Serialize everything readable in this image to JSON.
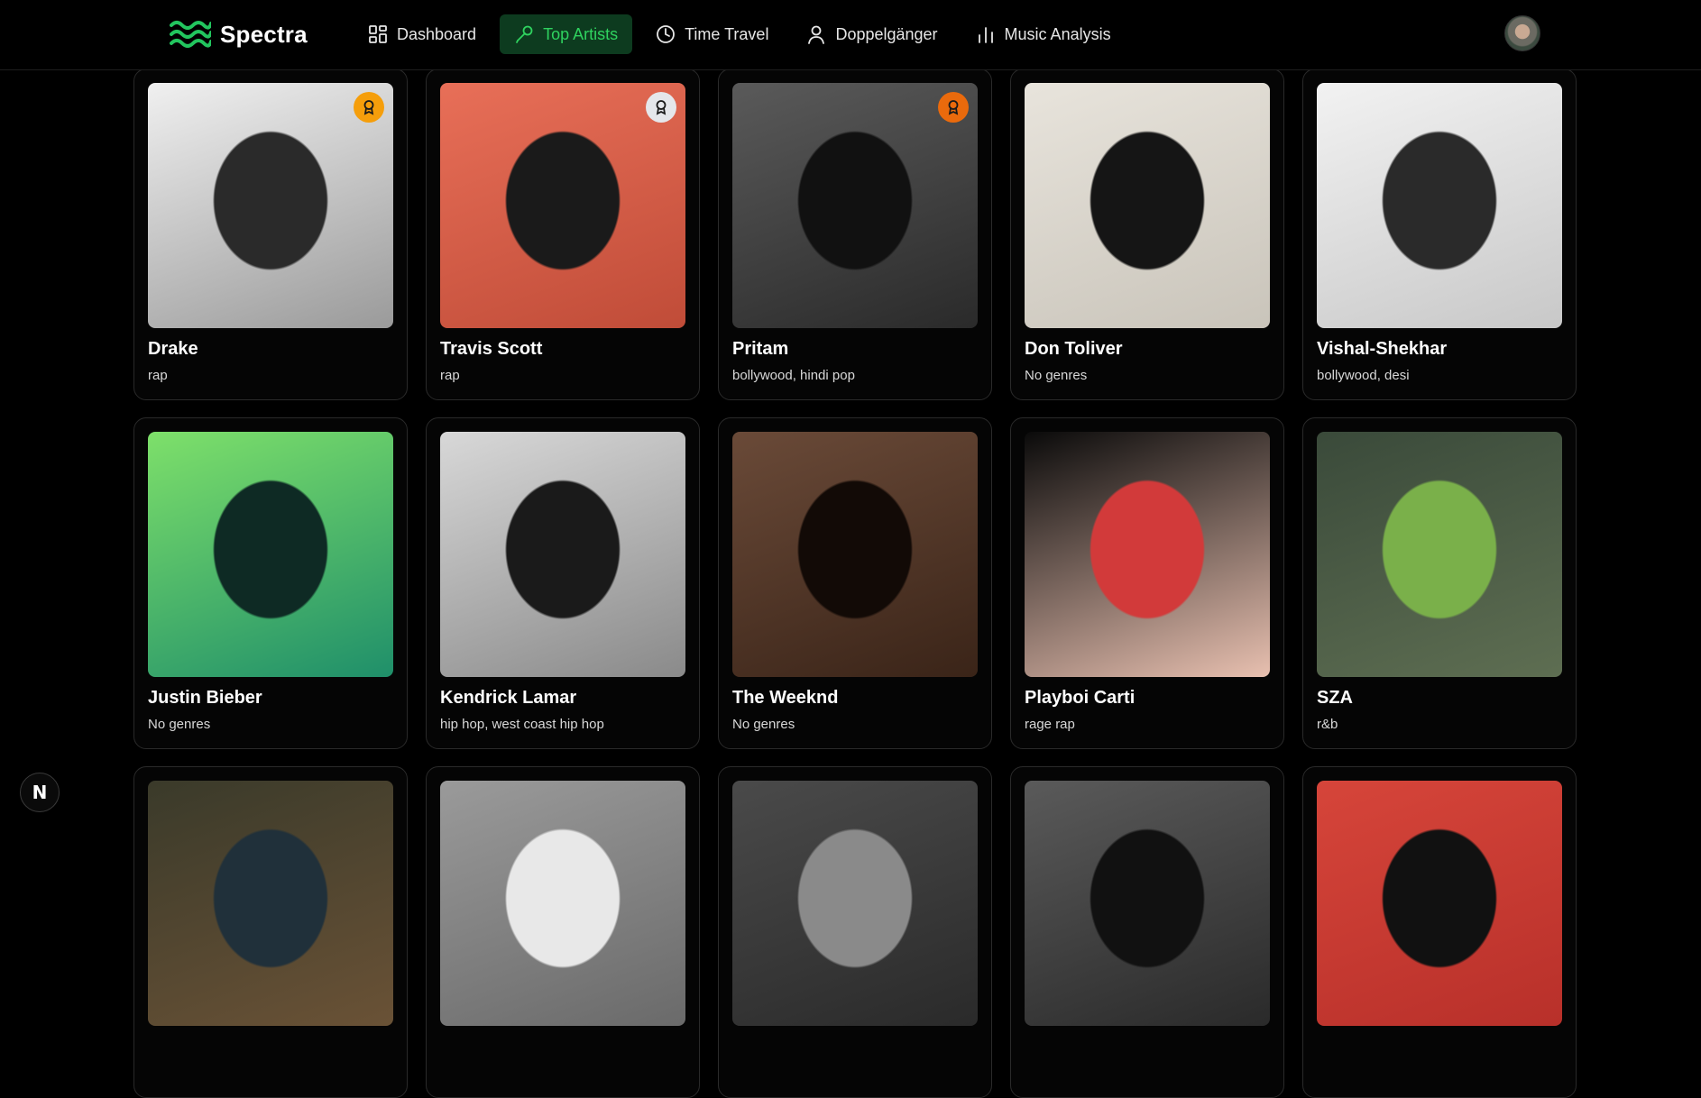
{
  "app": {
    "brand": "Spectra"
  },
  "nav": [
    {
      "label": "Dashboard",
      "icon": "dashboard-grid-icon",
      "active": false
    },
    {
      "label": "Top Artists",
      "icon": "microphone-icon",
      "active": true
    },
    {
      "label": "Time Travel",
      "icon": "clock-icon",
      "active": false
    },
    {
      "label": "Doppelgänger",
      "icon": "user-icon",
      "active": false
    },
    {
      "label": "Music Analysis",
      "icon": "bar-chart-icon",
      "active": false
    }
  ],
  "colors": {
    "accent": "#2fd25f",
    "active_bg": "#0d3b1f",
    "gold": "#f59e0b",
    "silver": "#e5e7eb",
    "bronze": "#ea6a0c"
  },
  "artists": [
    {
      "name": "Drake",
      "genres": "rap",
      "badge": "gold",
      "photo_colors": [
        "#f0f0f0",
        "#9a9a9a",
        "#2a2a2a"
      ]
    },
    {
      "name": "Travis Scott",
      "genres": "rap",
      "badge": "silver",
      "photo_colors": [
        "#e86f58",
        "#c04c38",
        "#1a1a1a"
      ]
    },
    {
      "name": "Pritam",
      "genres": "bollywood, hindi pop",
      "badge": "bronze",
      "photo_colors": [
        "#5a5a5a",
        "#2a2a2a",
        "#111111"
      ]
    },
    {
      "name": "Don Toliver",
      "genres": "No genres",
      "badge": "",
      "photo_colors": [
        "#e8e4dc",
        "#c9c4ba",
        "#151515"
      ]
    },
    {
      "name": "Vishal-Shekhar",
      "genres": "bollywood, desi",
      "badge": "",
      "photo_colors": [
        "#f2f2f2",
        "#c8c8c8",
        "#2a2a2a"
      ]
    },
    {
      "name": "Justin Bieber",
      "genres": "No genres",
      "badge": "",
      "photo_colors": [
        "#7ee06a",
        "#1f8f6a",
        "#0e2a24"
      ]
    },
    {
      "name": "Kendrick Lamar",
      "genres": "hip hop, west coast hip hop",
      "badge": "",
      "photo_colors": [
        "#d8d8d8",
        "#8a8a8a",
        "#1a1a1a"
      ]
    },
    {
      "name": "The Weeknd",
      "genres": "No genres",
      "badge": "",
      "photo_colors": [
        "#6a4a38",
        "#3a2418",
        "#120a06"
      ]
    },
    {
      "name": "Playboi Carti",
      "genres": "rage rap",
      "badge": "",
      "photo_colors": [
        "#0a0a0a",
        "#e8c0b0",
        "#d23a3a"
      ]
    },
    {
      "name": "SZA",
      "genres": "r&b",
      "badge": "",
      "photo_colors": [
        "#3a4a3a",
        "#5e6e52",
        "#7ab04a"
      ]
    },
    {
      "name": "",
      "genres": "",
      "badge": "",
      "photo_colors": [
        "#3a3a2a",
        "#6a5236",
        "#20303a"
      ]
    },
    {
      "name": "",
      "genres": "",
      "badge": "",
      "photo_colors": [
        "#9a9a9a",
        "#6a6a6a",
        "#e8e8e8"
      ]
    },
    {
      "name": "",
      "genres": "",
      "badge": "",
      "photo_colors": [
        "#4a4a4a",
        "#2a2a2a",
        "#8a8a8a"
      ]
    },
    {
      "name": "",
      "genres": "",
      "badge": "",
      "photo_colors": [
        "#5a5a5a",
        "#2a2a2a",
        "#111111"
      ]
    },
    {
      "name": "",
      "genres": "",
      "badge": "",
      "photo_colors": [
        "#d6453a",
        "#b8302a",
        "#111111"
      ]
    }
  ],
  "dev_indicator": "N"
}
